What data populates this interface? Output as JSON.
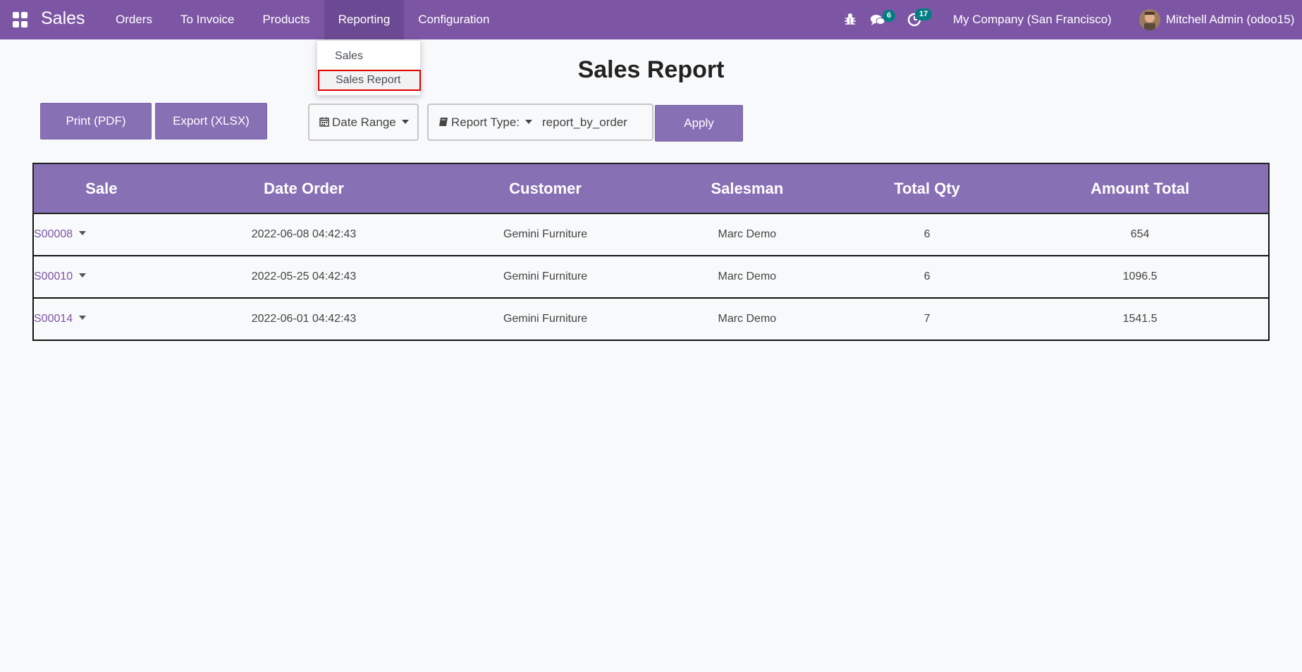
{
  "navbar": {
    "app_name": "Sales",
    "menu": [
      "Orders",
      "To Invoice",
      "Products",
      "Reporting",
      "Configuration"
    ],
    "active_menu": "Reporting",
    "messages_count": "6",
    "activities_count": "17",
    "company": "My Company (San Francisco)",
    "user": "Mitchell Admin (odoo15)",
    "icons": [
      "apps-icon",
      "bug-icon",
      "chat-icon",
      "clock-icon",
      "avatar"
    ]
  },
  "dropdown": {
    "items": [
      "Sales",
      "Sales Report"
    ],
    "highlighted": "Sales Report"
  },
  "page": {
    "title": "Sales Report",
    "print_label": "Print (PDF)",
    "export_label": "Export (XLSX)",
    "date_range_label": "Date Range",
    "report_type_label": "Report Type:",
    "report_type_value": "report_by_order",
    "apply_label": "Apply"
  },
  "table": {
    "headers": [
      "Sale",
      "Date Order",
      "Customer",
      "Salesman",
      "Total Qty",
      "Amount Total"
    ],
    "rows": [
      [
        "S00008",
        "2022-06-08 04:42:43",
        "Gemini Furniture",
        "Marc Demo",
        "6",
        "654"
      ],
      [
        "S00010",
        "2022-05-25 04:42:43",
        "Gemini Furniture",
        "Marc Demo",
        "6",
        "1096.5"
      ],
      [
        "S00014",
        "2022-06-01 04:42:43",
        "Gemini Furniture",
        "Marc Demo",
        "7",
        "1541.5"
      ]
    ]
  },
  "colors": {
    "navbar": "#7c56a4",
    "button": "#8870b5",
    "badge": "#017e84",
    "highlight_border": "#dd0000"
  }
}
